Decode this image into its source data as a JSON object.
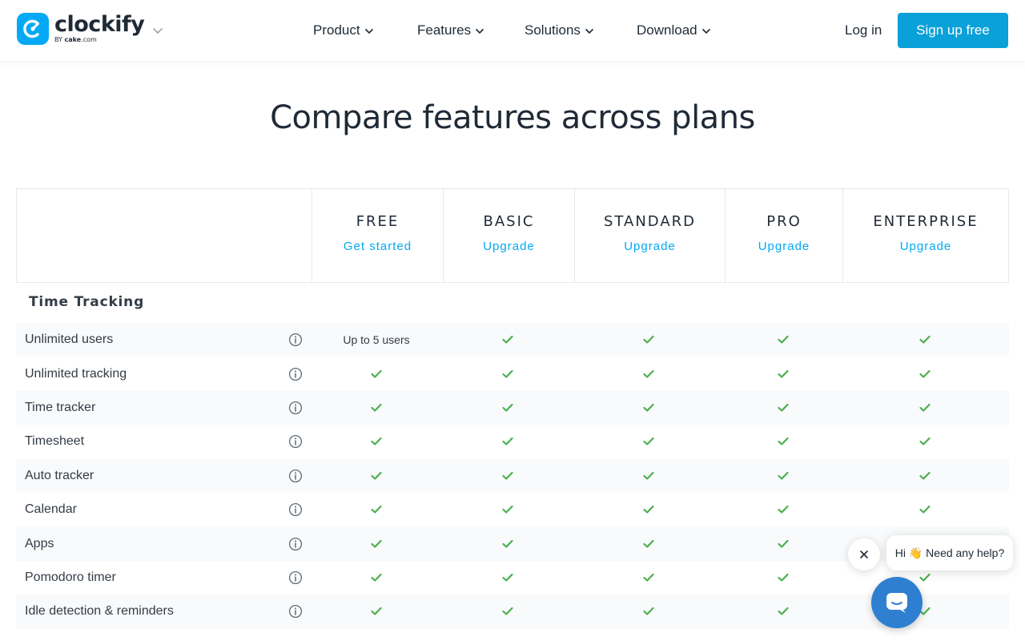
{
  "header": {
    "logo": {
      "name": "clockify",
      "by_prefix": "BY",
      "by_brand": "cake",
      "by_suffix": ".com"
    },
    "nav": [
      {
        "label": "Product"
      },
      {
        "label": "Features"
      },
      {
        "label": "Solutions"
      },
      {
        "label": "Download"
      }
    ],
    "login_label": "Log in",
    "signup_label": "Sign up free"
  },
  "page_title": "Compare features across plans",
  "plans": [
    {
      "name": "FREE",
      "cta": "Get started"
    },
    {
      "name": "BASIC",
      "cta": "Upgrade"
    },
    {
      "name": "STANDARD",
      "cta": "Upgrade"
    },
    {
      "name": "PRO",
      "cta": "Upgrade"
    },
    {
      "name": "ENTERPRISE",
      "cta": "Upgrade"
    }
  ],
  "section": {
    "title": "Time Tracking",
    "features": [
      {
        "label": "Unlimited users",
        "free_text": "Up to 5 users"
      },
      {
        "label": "Unlimited tracking"
      },
      {
        "label": "Time tracker"
      },
      {
        "label": "Timesheet"
      },
      {
        "label": "Auto tracker"
      },
      {
        "label": "Calendar"
      },
      {
        "label": "Apps"
      },
      {
        "label": "Pomodoro timer"
      },
      {
        "label": "Idle detection & reminders"
      }
    ]
  },
  "chat": {
    "message": "Hi 👋 Need any help?"
  },
  "colors": {
    "accent": "#03a9f4",
    "check": "#4caf50",
    "chat_launcher": "#2e7fd0"
  }
}
